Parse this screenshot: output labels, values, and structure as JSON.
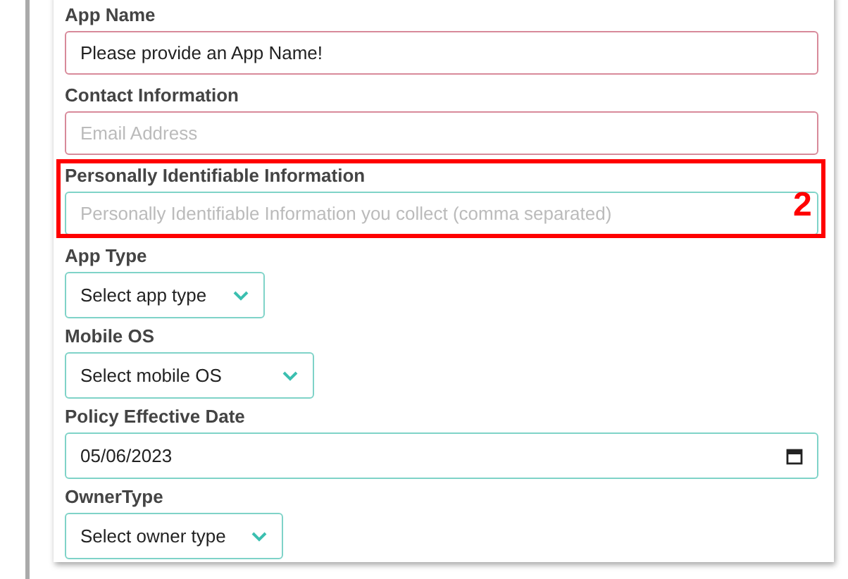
{
  "fields": [
    {
      "label": "App Name",
      "kind": "text",
      "value": "Please provide an App Name!",
      "invalid": true,
      "highlighted": false
    },
    {
      "label": "Contact Information",
      "kind": "text",
      "placeholder": "Email Address",
      "invalid": true,
      "highlighted": false
    },
    {
      "label": "Personally Identifiable Information",
      "kind": "text",
      "placeholder": "Personally Identifiable Information you collect (comma separated)",
      "invalid": false,
      "highlighted": true,
      "callout": "2"
    },
    {
      "label": "App Type",
      "kind": "select",
      "value": "Select app type",
      "invalid": false,
      "highlighted": false
    },
    {
      "label": "Mobile OS",
      "kind": "select",
      "value": "Select mobile OS",
      "invalid": false,
      "highlighted": false
    },
    {
      "label": "Policy Effective Date",
      "kind": "date",
      "value": "05/06/2023",
      "invalid": false,
      "highlighted": false
    },
    {
      "label": "OwnerType",
      "kind": "select",
      "value": "Select owner type",
      "invalid": false,
      "highlighted": false
    }
  ]
}
